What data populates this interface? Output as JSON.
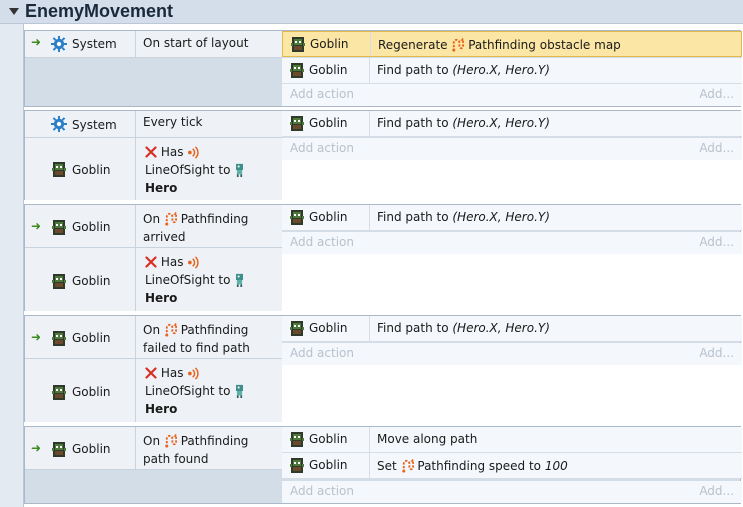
{
  "group": {
    "title": "EnemyMovement"
  },
  "labels": {
    "system": "System",
    "goblin": "Goblin",
    "add_action": "Add action",
    "add": "Add...",
    "has": "Has",
    "line_of_sight_to": "LineOfSight to",
    "hero": "Hero",
    "pathfinding": "Pathfinding",
    "find_path_to": "Find path to",
    "hero_xy": "(Hero.X, Hero.Y)"
  },
  "events": [
    {
      "condition_text": "On start of layout",
      "actions": [
        {
          "object": "Goblin",
          "prefix": "Regenerate",
          "behavior": "Pathfinding",
          "suffix": "obstacle map"
        },
        {
          "object": "Goblin",
          "text": "Find path to",
          "param": "(Hero.X, Hero.Y)"
        }
      ]
    },
    {
      "condition_text": "Every tick",
      "actions": [
        {
          "object": "Goblin",
          "text": "Find path to",
          "param": "(Hero.X, Hero.Y)"
        }
      ]
    },
    {
      "trigger_prefix": "On",
      "trigger_suffix": "arrived",
      "actions": [
        {
          "object": "Goblin",
          "text": "Find path to",
          "param": "(Hero.X, Hero.Y)"
        }
      ]
    },
    {
      "trigger_prefix": "On",
      "trigger_suffix": "failed to find path",
      "actions": [
        {
          "object": "Goblin",
          "text": "Find path to",
          "param": "(Hero.X, Hero.Y)"
        }
      ]
    },
    {
      "trigger_prefix": "On",
      "trigger_suffix": "path found",
      "actions": [
        {
          "object": "Goblin",
          "text": "Move along path"
        },
        {
          "object": "Goblin",
          "prefix": "Set",
          "behavior": "Pathfinding",
          "suffix": "speed to",
          "value": "100"
        }
      ]
    }
  ],
  "colors": {
    "header_bg": "#d3deea",
    "selected_action": "#fbe6a5",
    "trigger_arrow": "#3a8a1f",
    "invert_x": "#d93025",
    "behavior_icon": "#e8641e"
  },
  "icons": {
    "system": "gear-icon",
    "goblin": "goblin-sprite-icon",
    "pathfinding": "pathfinding-behavior-icon",
    "line_of_sight": "line-of-sight-icon",
    "hero": "hero-sprite-icon",
    "invert": "x-icon",
    "trigger": "green-arrow-icon"
  }
}
